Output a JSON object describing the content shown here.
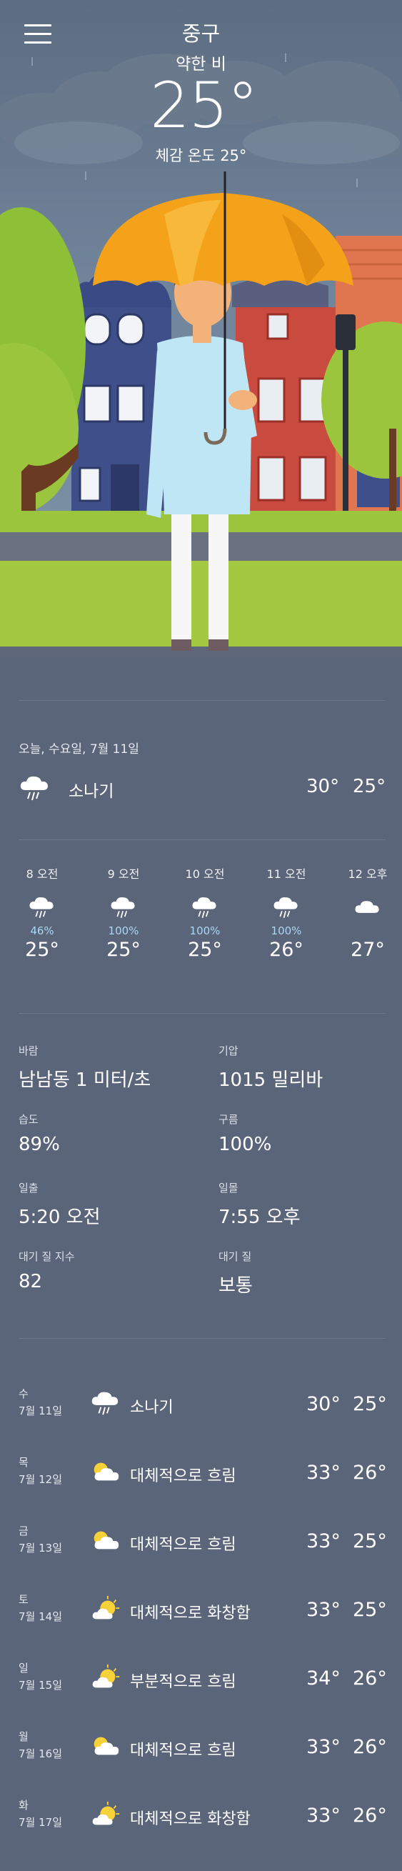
{
  "header": {
    "location": "중구",
    "condition": "약한 비",
    "temperature": "25°",
    "feels_like": "체감 온도 25°"
  },
  "today": {
    "date": "오늘, 수요일, 7월 11일",
    "condition": "소나기",
    "high": "30°",
    "low": "25°",
    "icon": "cloud-rain-icon"
  },
  "hourly": [
    {
      "time": "8 오전",
      "icon": "cloud-rain-icon",
      "precip": "46%",
      "temp": "25°"
    },
    {
      "time": "9 오전",
      "icon": "cloud-rain-icon",
      "precip": "100%",
      "temp": "25°"
    },
    {
      "time": "10 오전",
      "icon": "cloud-rain-icon",
      "precip": "100%",
      "temp": "25°"
    },
    {
      "time": "11 오전",
      "icon": "cloud-rain-icon",
      "precip": "100%",
      "temp": "26°"
    },
    {
      "time": "12 오후",
      "icon": "cloud-icon",
      "precip": "",
      "temp": "27°"
    }
  ],
  "details": {
    "wind_label": "바람",
    "wind_value": "남남동 1 미터/초",
    "pressure_label": "기압",
    "pressure_value": "1015 밀리바",
    "humidity_label": "습도",
    "humidity_value": "89%",
    "cloud_label": "구름",
    "cloud_value": "100%",
    "sunrise_label": "일출",
    "sunrise_value": "5:20 오전",
    "sunset_label": "일몰",
    "sunset_value": "7:55 오후",
    "aqi_label": "대기 질 지수",
    "aqi_value": "82",
    "aq_label": "대기 질",
    "aq_value": "보통"
  },
  "daily": [
    {
      "dow": "수",
      "date": "7월 11일",
      "icon": "cloud-rain-icon",
      "condition": "소나기",
      "high": "30°",
      "low": "25°"
    },
    {
      "dow": "목",
      "date": "7월 12일",
      "icon": "partly-cloudy-icon",
      "condition": "대체적으로 흐림",
      "high": "33°",
      "low": "26°"
    },
    {
      "dow": "금",
      "date": "7월 13일",
      "icon": "partly-cloudy-icon",
      "condition": "대체적으로 흐림",
      "high": "33°",
      "low": "25°"
    },
    {
      "dow": "토",
      "date": "7월 14일",
      "icon": "mostly-sunny-icon",
      "condition": "대체적으로 화창함",
      "high": "33°",
      "low": "25°"
    },
    {
      "dow": "일",
      "date": "7월 15일",
      "icon": "mostly-sunny-icon",
      "condition": "부분적으로 흐림",
      "high": "34°",
      "low": "26°"
    },
    {
      "dow": "월",
      "date": "7월 16일",
      "icon": "partly-cloudy-icon",
      "condition": "대체적으로 흐림",
      "high": "33°",
      "low": "26°"
    },
    {
      "dow": "화",
      "date": "7월 17일",
      "icon": "mostly-sunny-icon",
      "condition": "대체적으로 화창함",
      "high": "33°",
      "low": "26°"
    }
  ],
  "colors": {
    "background": "#5b657a",
    "precip_text": "#a9d7f5",
    "umbrella": "#f5a21b",
    "grass": "#9bc53d"
  }
}
